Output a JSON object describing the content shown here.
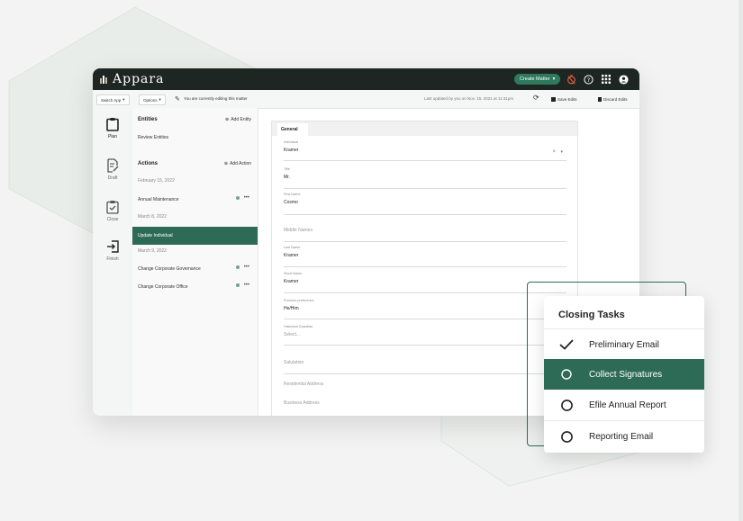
{
  "app": {
    "name": "Appara",
    "create_button": "Create Matter",
    "switch_app": "Switch App",
    "options": "Options",
    "editing_notice": "You are currently editing this matter",
    "last_updated": "Last updated by you on Nov. 15, 2021 at 11:31pm",
    "save_edits": "Save Edits",
    "discard_edits": "Discard Edits"
  },
  "sidebar": {
    "items": [
      {
        "label": "Plan"
      },
      {
        "label": "Draft"
      },
      {
        "label": "Close"
      },
      {
        "label": "Finish"
      }
    ]
  },
  "entities": {
    "title": "Entities",
    "add_label": "Add Entity",
    "review": "Review Entities"
  },
  "actions": {
    "title": "Actions",
    "add_label": "Add Action",
    "rows": [
      {
        "date": "February 15, 2022"
      },
      {
        "label": "Annual Maintenance",
        "status": "active"
      },
      {
        "date": "March 8, 2022"
      },
      {
        "label": "Update Individual",
        "selected": true
      },
      {
        "date": "March 9, 2022"
      },
      {
        "label": "Change Corporate Governance",
        "status": "active"
      },
      {
        "label": "Change Corporate Office",
        "status": "active"
      }
    ],
    "more": "•••"
  },
  "form": {
    "tab": "General",
    "fields": [
      {
        "label": "Individual",
        "value": "Kramer"
      },
      {
        "label": "Title",
        "value": "Mr."
      },
      {
        "label": "First Name",
        "value": "Cosmo"
      },
      {
        "placeholder": "Middle Names"
      },
      {
        "label": "Last Name",
        "value": "Kramer"
      },
      {
        "label": "Short Name",
        "value": "Kramer"
      },
      {
        "label": "Pronoun preference",
        "value": "He/Him"
      },
      {
        "label": "Historical Guardian",
        "placeholder": "Select..."
      },
      {
        "placeholder": "Salutation"
      },
      {
        "placeholder": "Residential Address"
      },
      {
        "placeholder": "Business Address"
      }
    ]
  },
  "closing_tasks": {
    "title": "Closing Tasks",
    "items": [
      {
        "label": "Preliminary Email",
        "state": "done"
      },
      {
        "label": "Collect Signatures",
        "state": "active"
      },
      {
        "label": "Efile Annual Report",
        "state": "todo"
      },
      {
        "label": "Reporting Email",
        "state": "todo"
      }
    ]
  },
  "colors": {
    "brand_green": "#2e6b57",
    "topbar": "#1e2624",
    "alert_orange": "#e2623a"
  }
}
